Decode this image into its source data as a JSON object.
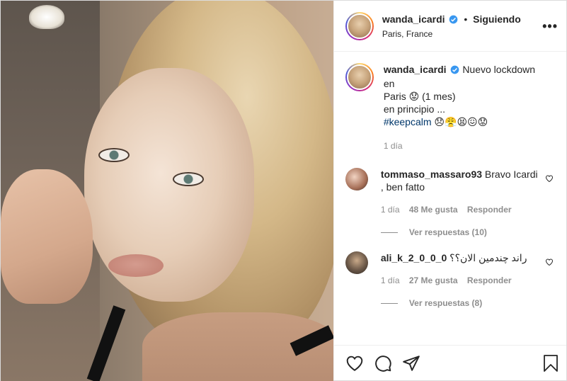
{
  "post": {
    "author": "wanda_icardi",
    "follow_separator": "•",
    "follow_status": "Siguiendo",
    "location": "Paris, France",
    "more": "•••"
  },
  "caption": {
    "username": "wanda_icardi",
    "text_line1": "Nuevo lockdown en",
    "text_line2": "Paris 😟 (1 mes)",
    "text_line3": "en principio ...",
    "hashtag": "#keepcalm",
    "emojis": "😞😤😫😖😟",
    "time": "1 día"
  },
  "comments": [
    {
      "username": "tommaso_massaro93",
      "text": "Bravo Icardi , ben fatto",
      "time": "1 día",
      "likes": "48 Me gusta",
      "reply": "Responder",
      "view_replies": "Ver respuestas (10)"
    },
    {
      "username": "ali_k_2_0_0_0",
      "text": "راند چندمین الان؟؟",
      "time": "1 día",
      "likes": "27 Me gusta",
      "reply": "Responder",
      "view_replies": "Ver respuestas (8)"
    }
  ],
  "icons": {
    "verified": "verified-badge-icon",
    "like": "heart-icon",
    "comment": "comment-icon",
    "share": "share-icon",
    "save": "bookmark-icon"
  },
  "colors": {
    "verified_blue": "#3897f0",
    "hashtag": "#00376b",
    "secondary_text": "#8e8e8e"
  }
}
